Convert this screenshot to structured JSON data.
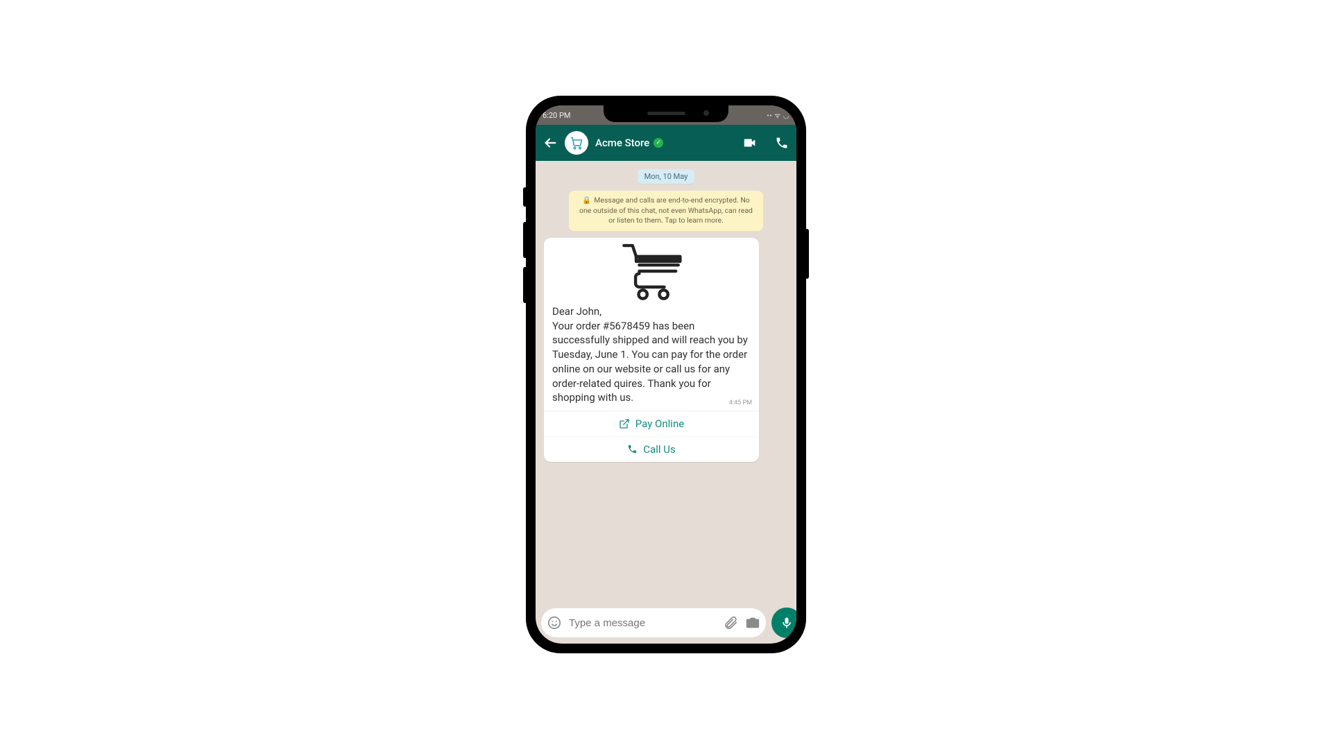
{
  "status": {
    "time": "6:20 PM",
    "indicators": "••  ᯤ  ◡"
  },
  "header": {
    "contact_name": "Acme Store"
  },
  "chat": {
    "date_label": "Mon, 10 May",
    "encryption_notice": "Message and calls are end-to-end encrypted. No one outside of this chat, not even WhatsApp, can read or listen to them. Tap to learn more.",
    "message": {
      "greeting": "Dear John,",
      "body": "Your order #5678459 has been successfully shipped and will reach you by Tuesday, June 1. You can pay for the order online on our website or call us for any order-related quires. Thank you for shopping with us.",
      "time": "4:45 PM",
      "action_pay": "Pay Online",
      "action_call": "Call Us"
    }
  },
  "input": {
    "placeholder": "Type a message"
  }
}
